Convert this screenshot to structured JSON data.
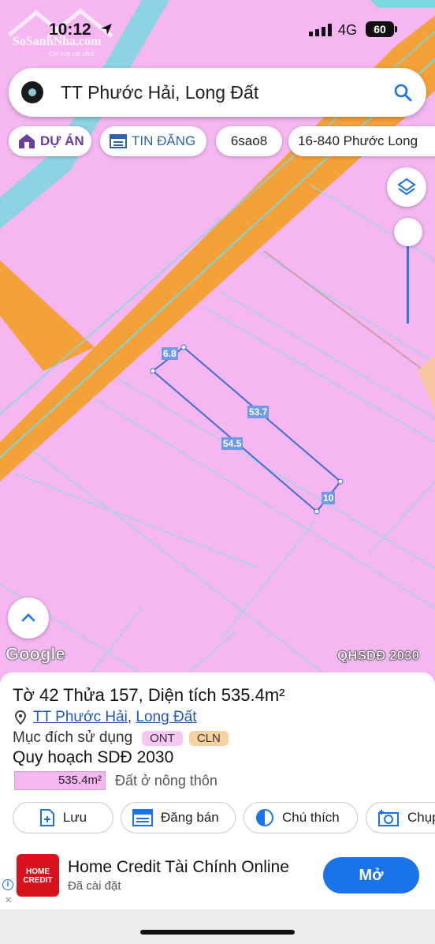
{
  "status_bar": {
    "time": "10:12",
    "network": "4G",
    "battery": "60",
    "watermark": "SoSanhNha.com",
    "watermark_sub": "Chỉ một cái click"
  },
  "search": {
    "query": "TT Phước Hải, Long Đất"
  },
  "chips": [
    {
      "label": "DỰ ÁN",
      "icon": "house-icon"
    },
    {
      "label": "TIN ĐĂNG",
      "icon": "listing-icon"
    },
    {
      "label": "6sao8"
    },
    {
      "label": "16-840 Phước Long"
    }
  ],
  "map": {
    "dimensions": [
      "6.8",
      "53.7",
      "54.5",
      "10"
    ],
    "attribution": "Google",
    "plan_layer": "QHSDĐ 2030"
  },
  "parcel": {
    "title": "Tờ 42 Thửa 157, Diện tích 535.4m²",
    "commune": "TT Phước Hải",
    "district": "Long Đất",
    "purpose_label": "Mục đích sử dụng",
    "tags": [
      {
        "label": "ONT",
        "color": "#f7c6f1"
      },
      {
        "label": "CLN",
        "color": "#f8d1a0"
      }
    ],
    "plan_title": "Quy hoạch SDĐ 2030",
    "plan_area": "535.4m²",
    "plan_land_use": "Đất ở nông thôn"
  },
  "actions": [
    "Lưu",
    "Đăng bán",
    "Chú thích",
    "Chụp"
  ],
  "ad": {
    "logo_text": "HOME CREDIT",
    "title": "Home Credit Tài Chính Online",
    "subtitle": "Đã cài đặt",
    "button": "Mở"
  },
  "colors": {
    "map_background": "#f5b6f2",
    "road": "#f5a13a",
    "parcel_line": "#3a6fd8",
    "accent": "#1a73e8"
  }
}
